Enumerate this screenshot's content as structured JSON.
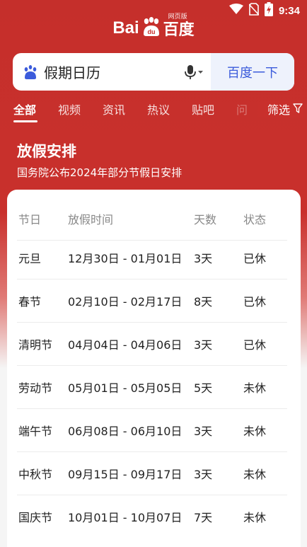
{
  "status_bar": {
    "time": "9:34",
    "icons": [
      "wifi-icon",
      "no-sim-icon",
      "battery-charging-icon"
    ]
  },
  "logo": {
    "text_left": "Bai",
    "text_right": "百度",
    "subtitle": "网页版"
  },
  "search": {
    "query": "假期日历",
    "button_label": "百度一下",
    "icons": [
      "paw-icon",
      "microphone-icon"
    ]
  },
  "tabs": [
    {
      "label": "全部",
      "active": true
    },
    {
      "label": "视频",
      "active": false
    },
    {
      "label": "资讯",
      "active": false
    },
    {
      "label": "热议",
      "active": false
    },
    {
      "label": "贴吧",
      "active": false
    },
    {
      "label": "问",
      "active": false
    }
  ],
  "filter": {
    "label": "筛选",
    "icon": "funnel-icon"
  },
  "result": {
    "title": "放假安排",
    "subtitle": "国务院公布2024年部分节假日安排"
  },
  "table": {
    "headers": [
      "节日",
      "放假时间",
      "天数",
      "状态"
    ],
    "rows": [
      [
        "元旦",
        "12月30日 - 01月01日",
        "3天",
        "已休"
      ],
      [
        "春节",
        "02月10日 - 02月17日",
        "8天",
        "已休"
      ],
      [
        "清明节",
        "04月04日 - 04月06日",
        "3天",
        "已休"
      ],
      [
        "劳动节",
        "05月01日 - 05月05日",
        "5天",
        "未休"
      ],
      [
        "端午节",
        "06月08日 - 06月10日",
        "3天",
        "未休"
      ],
      [
        "中秋节",
        "09月15日 - 09月17日",
        "3天",
        "未休"
      ],
      [
        "国庆节",
        "10月01日 - 10月07日",
        "7天",
        "未休"
      ]
    ]
  },
  "colors": {
    "brand_red": "#c9302c",
    "search_button_text": "#3b5bdb",
    "search_button_bg": "#eef2fc"
  }
}
